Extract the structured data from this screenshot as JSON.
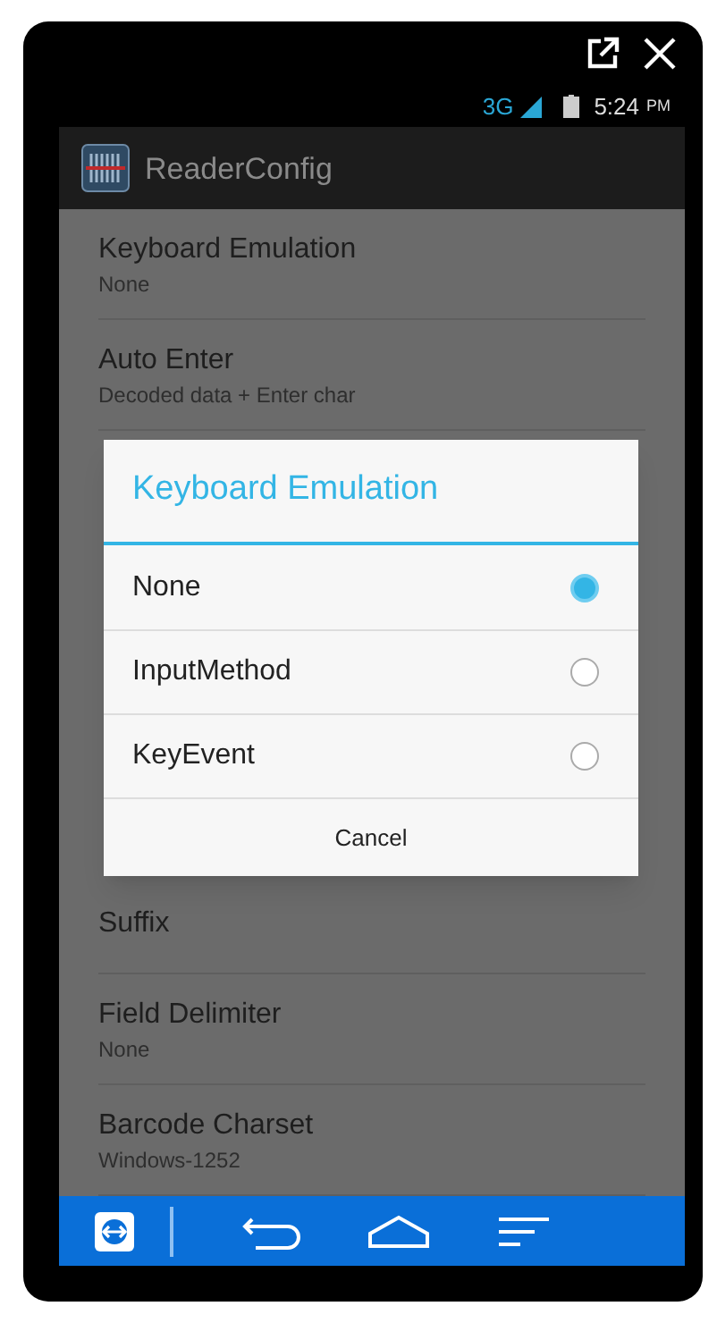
{
  "status_bar": {
    "network": "3G",
    "time": "5:24",
    "ampm": "PM"
  },
  "app_bar": {
    "title": "ReaderConfig"
  },
  "settings": [
    {
      "title": "Keyboard Emulation",
      "summary": "None"
    },
    {
      "title": "Auto Enter",
      "summary": "Decoded data + Enter char"
    },
    {
      "title": "Suffix"
    },
    {
      "title": "Field Delimiter",
      "summary": "None"
    },
    {
      "title": "Barcode Charset",
      "summary": "Windows-1252"
    }
  ],
  "dialog": {
    "title": "Keyboard Emulation",
    "options": [
      {
        "label": "None",
        "selected": true
      },
      {
        "label": "InputMethod",
        "selected": false
      },
      {
        "label": "KeyEvent",
        "selected": false
      }
    ],
    "button": "Cancel"
  }
}
